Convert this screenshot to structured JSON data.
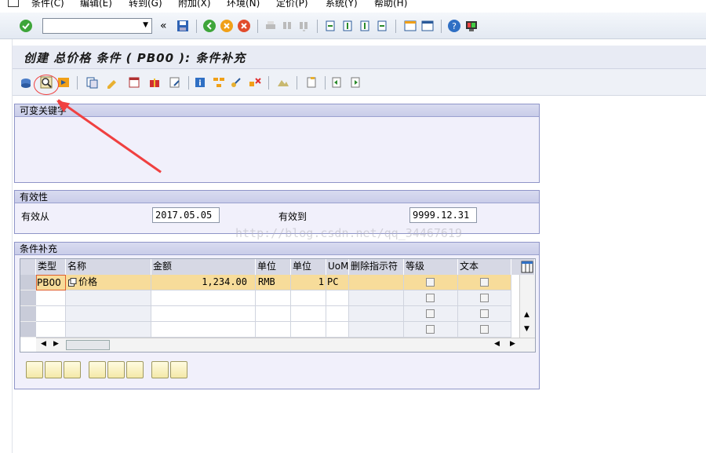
{
  "menu": {
    "items": [
      "条件(C)",
      "编辑(E)",
      "转到(G)",
      "附加(X)",
      "环境(N)",
      "定价(P)",
      "系统(Y)",
      "帮助(H)"
    ]
  },
  "toolbar": {
    "command_value": "",
    "icons": [
      "enter-icon",
      "back-icon",
      "exit-icon",
      "cancel-icon",
      "print-icon",
      "find-icon",
      "find-next-icon",
      "first-page-icon",
      "prev-page-icon",
      "next-page-icon",
      "last-page-icon",
      "new-session-icon",
      "shortcut-icon",
      "help-icon",
      "layout-icon"
    ]
  },
  "title": "创建 总价格 条件 ( PB00 ): 条件补充",
  "groups": {
    "variable_key": "可变关键字",
    "validity": {
      "title": "有效性",
      "from_label": "有效从",
      "from_value": "2017.05.05",
      "to_label": "有效到",
      "to_value": "9999.12.31"
    },
    "supplement": {
      "title": "条件补充",
      "headers": [
        "类型",
        "名称",
        "金额",
        "单位",
        "单位",
        "UoM",
        "删除指示符",
        "等级",
        "文本"
      ],
      "rows": [
        {
          "type": "PB00",
          "name": "价格",
          "amount": "1,234.00",
          "currency": "RMB",
          "per": "1",
          "uom": "PC"
        }
      ]
    }
  },
  "watermark": "http://blog.csdn.net/qq_34467619",
  "colors": {
    "accent_row": "#f7dc9a",
    "annotation": "#f04040",
    "group_border": "#8f95c8"
  }
}
